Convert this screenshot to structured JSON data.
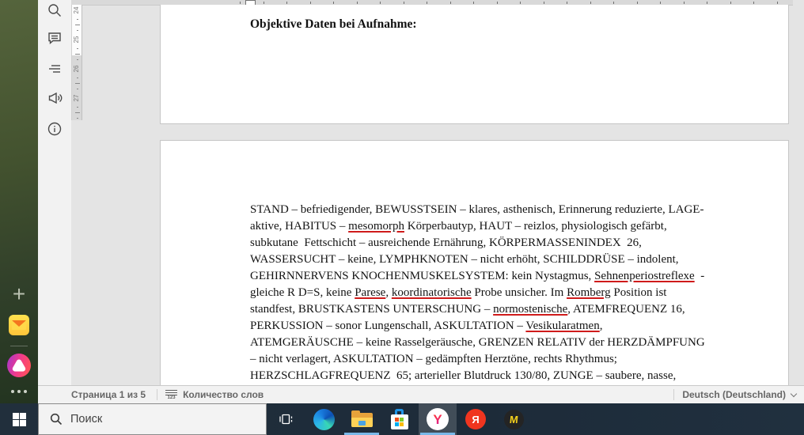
{
  "browser_sidebar": {
    "plus_glyph": "+"
  },
  "editor": {
    "left_toolbar": {
      "icons": [
        "search-icon",
        "comments-icon",
        "navigation-icon",
        "feedback-icon",
        "about-icon"
      ]
    },
    "vertical_ruler_numbers": [
      "24",
      "25",
      "26",
      "27"
    ],
    "document": {
      "page1_heading": "Objektive Daten bei Aufnahme:",
      "page2_lines": [
        [
          {
            "t": "STAND – befriedigender, BEWUSSTSEIN – klares, asthenisch, Erinnerung reduzierte, LAGE-"
          }
        ],
        [
          {
            "t": "aktive, HABITUS – "
          },
          {
            "t": "mesomorph",
            "u": true
          },
          {
            "t": " Körperbautyp, HAUT – reizlos, physiologisch gefärbt,"
          }
        ],
        [
          {
            "t": "subkutane  Fettschicht – ausreichende Ernährung, KÖRPERMASSENINDEX  26,"
          }
        ],
        [
          {
            "t": "WASSERSUCHT – keine, LYMPHKNOTEN – nicht erhöht, SCHILDDRÜSE – indolent,"
          }
        ],
        [
          {
            "t": "GEHIRNNERVENS KNOCHENMUSKELSYSTEM: kein Nystagmus, "
          },
          {
            "t": "Sehnenperiostreflexe",
            "u": true
          },
          {
            "t": "  -"
          }
        ],
        [
          {
            "t": "gleiche R D=S, keine "
          },
          {
            "t": "Parese",
            "u": true
          },
          {
            "t": ", "
          },
          {
            "t": "koordinatorische",
            "u": true
          },
          {
            "t": " Probe unsicher. Im "
          },
          {
            "t": "Romberg",
            "u": true
          },
          {
            "t": " Position ist"
          }
        ],
        [
          {
            "t": "standfest, BRUSTKASTENS UNTERSCHUNG – "
          },
          {
            "t": "normostenische",
            "u": true
          },
          {
            "t": ", ATEMFREQUENZ 16,"
          }
        ],
        [
          {
            "t": "PERKUSSION – sonor Lungenschall, ASKULTATION – "
          },
          {
            "t": "Vesikularatmen",
            "u": true
          },
          {
            "t": ","
          }
        ],
        [
          {
            "t": "ATEMGERÄUSCHE – keine Rasselgeräusche, GRENZEN RELATIV der HERZDÄMPFUNG"
          }
        ],
        [
          {
            "t": "– nicht verlagert, ASKULTATION – gedämpften Herztöne, rechts Rhythmus;"
          }
        ],
        [
          {
            "t": "HERZSCHLAGFREQUENZ  65; arterieller Blutdruck 130/80, ZUNGE – saubere, nasse,"
          }
        ]
      ]
    },
    "status_bar": {
      "page_indicator": "Страница 1 из 5",
      "word_count_label": "Количество слов",
      "word_count_icon_digits": "123",
      "language": "Deutsch (Deutschland)"
    }
  },
  "taskbar": {
    "search_placeholder": "Поиск",
    "yandex_browser_letter": "Y",
    "yandex_app_letter": "Я",
    "m_app_letter": "M"
  },
  "colors": {
    "misspell_underline": "#cf1b1b",
    "taskbar_bg": "#1d2b39",
    "taskbar_active_underline": "#79b8e8",
    "page_bg": "#ffffff",
    "workspace_bg": "#e4e4e4"
  }
}
